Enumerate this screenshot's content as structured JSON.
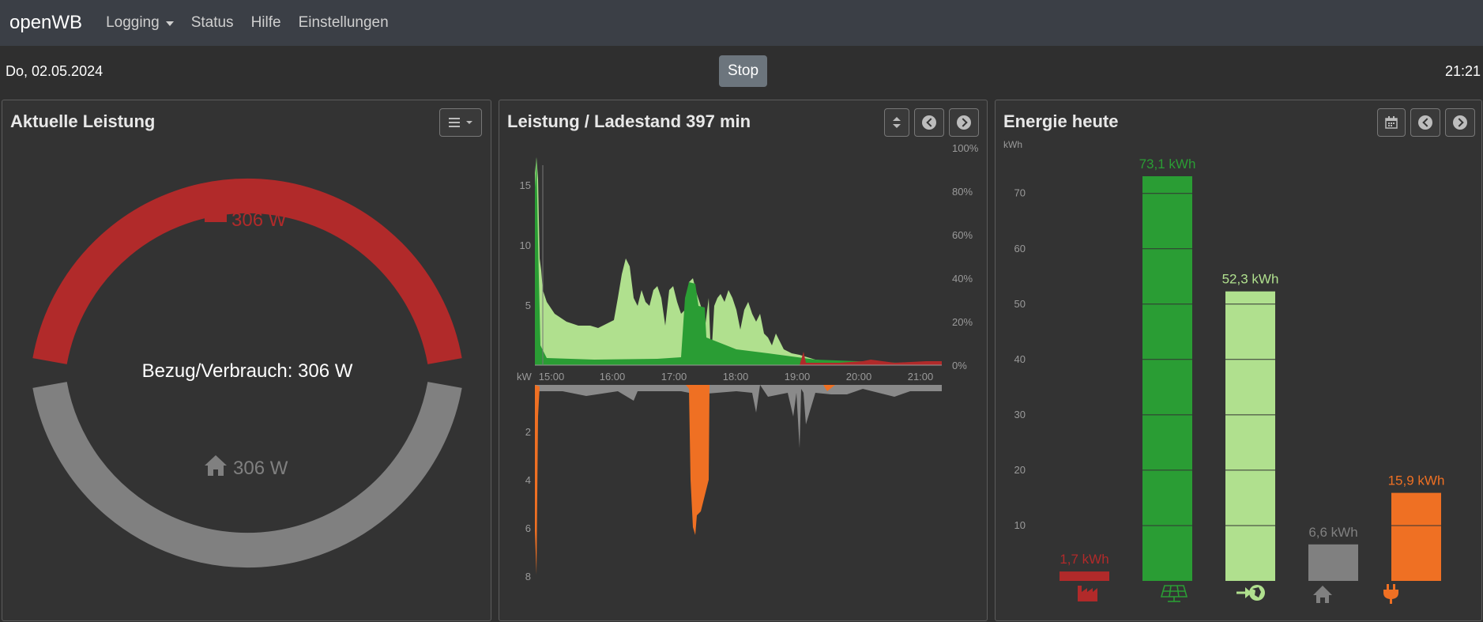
{
  "navbar": {
    "brand": "openWB",
    "items": [
      {
        "label": "Logging",
        "dropdown": true
      },
      {
        "label": "Status"
      },
      {
        "label": "Hilfe"
      },
      {
        "label": "Einstellungen"
      }
    ]
  },
  "subbar": {
    "date": "Do, 02.05.2024",
    "stop_label": "Stop",
    "time": "21:21"
  },
  "power_card": {
    "title": "Aktuelle Leistung",
    "grid_value": "306 W",
    "center_label": "Bezug/Verbrauch: 306 W",
    "house_value": "306 W",
    "colors": {
      "grid": "#b12a2a",
      "house": "#808080"
    }
  },
  "history_card": {
    "title": "Leistung / Ladestand 397 min",
    "chart_data": {
      "type": "area",
      "x_ticks": [
        "15:00",
        "16:00",
        "17:00",
        "18:00",
        "19:00",
        "20:00",
        "21:00"
      ],
      "y_top_ticks": [
        "15",
        "10",
        "5"
      ],
      "y_bottom_ticks": [
        "2",
        "4",
        "6",
        "8"
      ],
      "y_unit": "kW",
      "soc_ticks": [
        "100%",
        "80%",
        "60%",
        "40%",
        "20%",
        "0%"
      ],
      "series": [
        {
          "name": "",
          "color": "#b0e08e"
        },
        {
          "name": "",
          "color": "#2a9d34"
        },
        {
          "name": "",
          "color": "#b12a2a"
        },
        {
          "name": "",
          "color": "#8a8a8a"
        },
        {
          "name": "",
          "color": "#ef7023"
        }
      ]
    }
  },
  "energy_card": {
    "title": "Energie heute",
    "chart_data": {
      "type": "bar",
      "y_unit": "kWh",
      "y_ticks": [
        10,
        20,
        30,
        40,
        50,
        60,
        70
      ],
      "ylim": [
        0,
        73.1
      ],
      "bars": [
        {
          "label": "1,7 kWh",
          "value": 1.7,
          "color": "#b12a2a",
          "icon": "factory-icon"
        },
        {
          "label": "73,1 kWh",
          "value": 73.1,
          "color": "#2a9d34",
          "icon": "solar-panel-icon"
        },
        {
          "label": "52,3 kWh",
          "value": 52.3,
          "color": "#b0e08e",
          "icon": "export-globe-icon"
        },
        {
          "label": "6,6 kWh",
          "value": 6.6,
          "color": "#808080",
          "icon": "house-icon"
        },
        {
          "label": "15,9 kWh",
          "value": 15.9,
          "color": "#ef7023",
          "icon": "plug-icon"
        }
      ]
    }
  }
}
